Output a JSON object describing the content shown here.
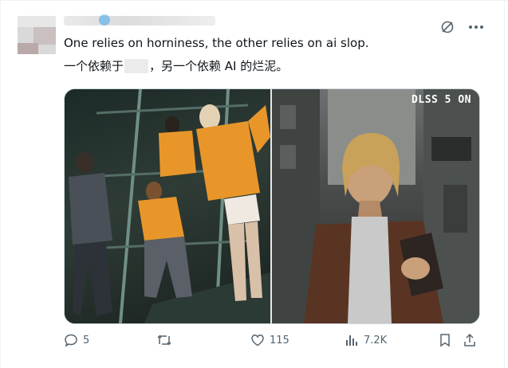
{
  "tweet": {
    "text_en": "One relies on horniness, the other relies on ai slop.",
    "text_zh_part1": "一个依赖于",
    "text_zh_part2": "，另一个依赖 AI 的烂泥。"
  },
  "media": {
    "watermark": "DLSS 5 ON"
  },
  "actions": {
    "replies": "5",
    "reposts": "",
    "likes": "115",
    "views": "7.2K"
  },
  "icons": {
    "reply": "reply-icon",
    "repost": "repost-icon",
    "like": "heart-icon",
    "views": "views-chart-icon",
    "bookmark": "bookmark-icon",
    "share": "share-icon",
    "grok": "grok-icon",
    "more": "more-icon"
  },
  "colors": {
    "icon_gray": "#536471",
    "verified": "#1d9bf0",
    "jacket_orange": "#e8962a"
  }
}
